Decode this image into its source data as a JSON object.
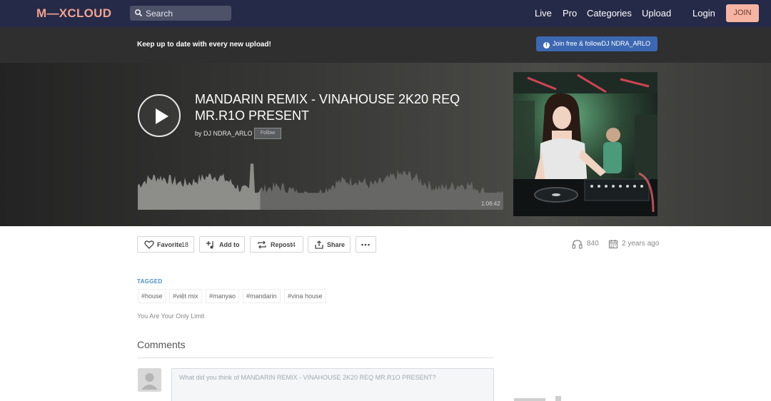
{
  "nav": {
    "logo": "M—XCLOUD",
    "search_placeholder": "Search",
    "links": [
      "Live",
      "Pro",
      "Categories",
      "Upload"
    ],
    "login": "Login",
    "join": "JOIN"
  },
  "promo": {
    "text": "Keep up to date with every new upload!",
    "button": "Join free & followDJ NDRA_ARLO",
    "fb_glyph": "f"
  },
  "show": {
    "title": "MANDARIN REMIX - VINAHOUSE 2K20 REQ MR.R1O PRESENT",
    "byline": "by DJ NDRA_ARLO",
    "follow": "Follow",
    "duration": "1:06:42",
    "progress_fraction": 0.335
  },
  "actions": {
    "favorite": "Favorite",
    "favorite_count": "18",
    "add_to": "Add to",
    "repost": "Repost",
    "repost_count": "4",
    "share": "Share",
    "plays": "840",
    "age": "2 years ago"
  },
  "tagged_label": "TAGGED",
  "tags": [
    "#house",
    "#việt mix",
    "#manyao",
    "#mandarin",
    "#vina house"
  ],
  "description": "You Are Your Only Limit",
  "comments": {
    "heading": "Comments",
    "placeholder": "What did you think of MANDARIN REMIX - VINAHOUSE 2K20 REQ MR.R1O PRESENT?"
  },
  "colors": {
    "nav_bg": "#252a48",
    "brand": "#f2a28e",
    "join_bg": "#f6b4a3",
    "facebook_blue": "#3c67b1",
    "tag_blue": "#4a90c2"
  },
  "icons": {
    "search": "search-icon",
    "play": "play-icon",
    "favorite": "heart-icon",
    "add_to": "add-to-playlist-icon",
    "repost": "repost-icon",
    "share": "share-icon",
    "more": "more-dots-icon",
    "plays": "headphones-icon",
    "date": "calendar-icon",
    "avatar": "user-avatar-icon"
  }
}
